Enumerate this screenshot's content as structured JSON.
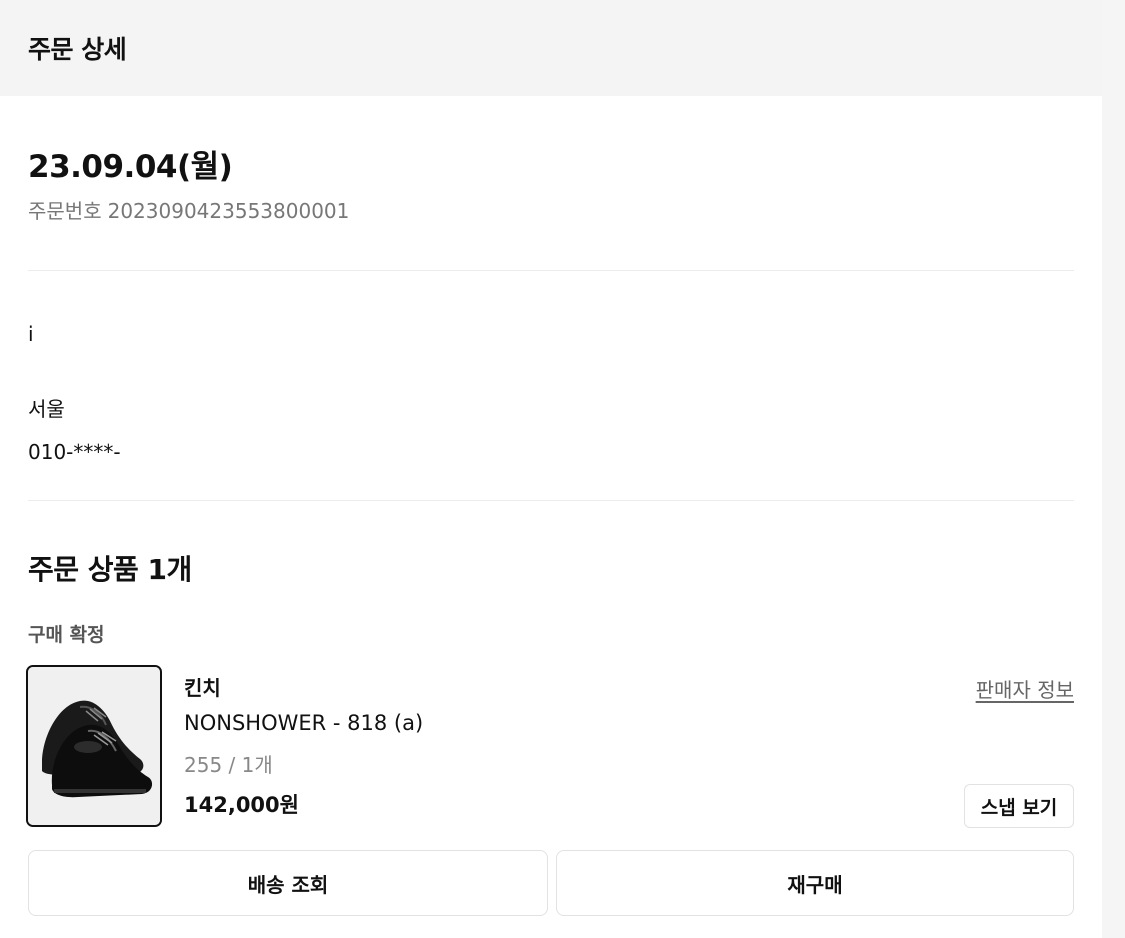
{
  "header": {
    "title": "주문 상세"
  },
  "order": {
    "date": "23.09.04(월)",
    "number_label": "주문번호",
    "number": "2023090423553800001"
  },
  "shipping": {
    "name": "i",
    "address": "서울 ",
    "phone": "010-****-"
  },
  "items_section": {
    "title": "주문 상품 1개",
    "status": "구매 확정"
  },
  "item": {
    "image_icon": "shoe-product-image",
    "brand": "킨치",
    "name": "NONSHOWER - 818 (a)",
    "option": "255 / 1개",
    "price": "142,000원",
    "seller_link": "판매자 정보",
    "snap_button": "스냅 보기"
  },
  "actions": {
    "track_delivery": "배송 조회",
    "rebuy": "재구매"
  }
}
